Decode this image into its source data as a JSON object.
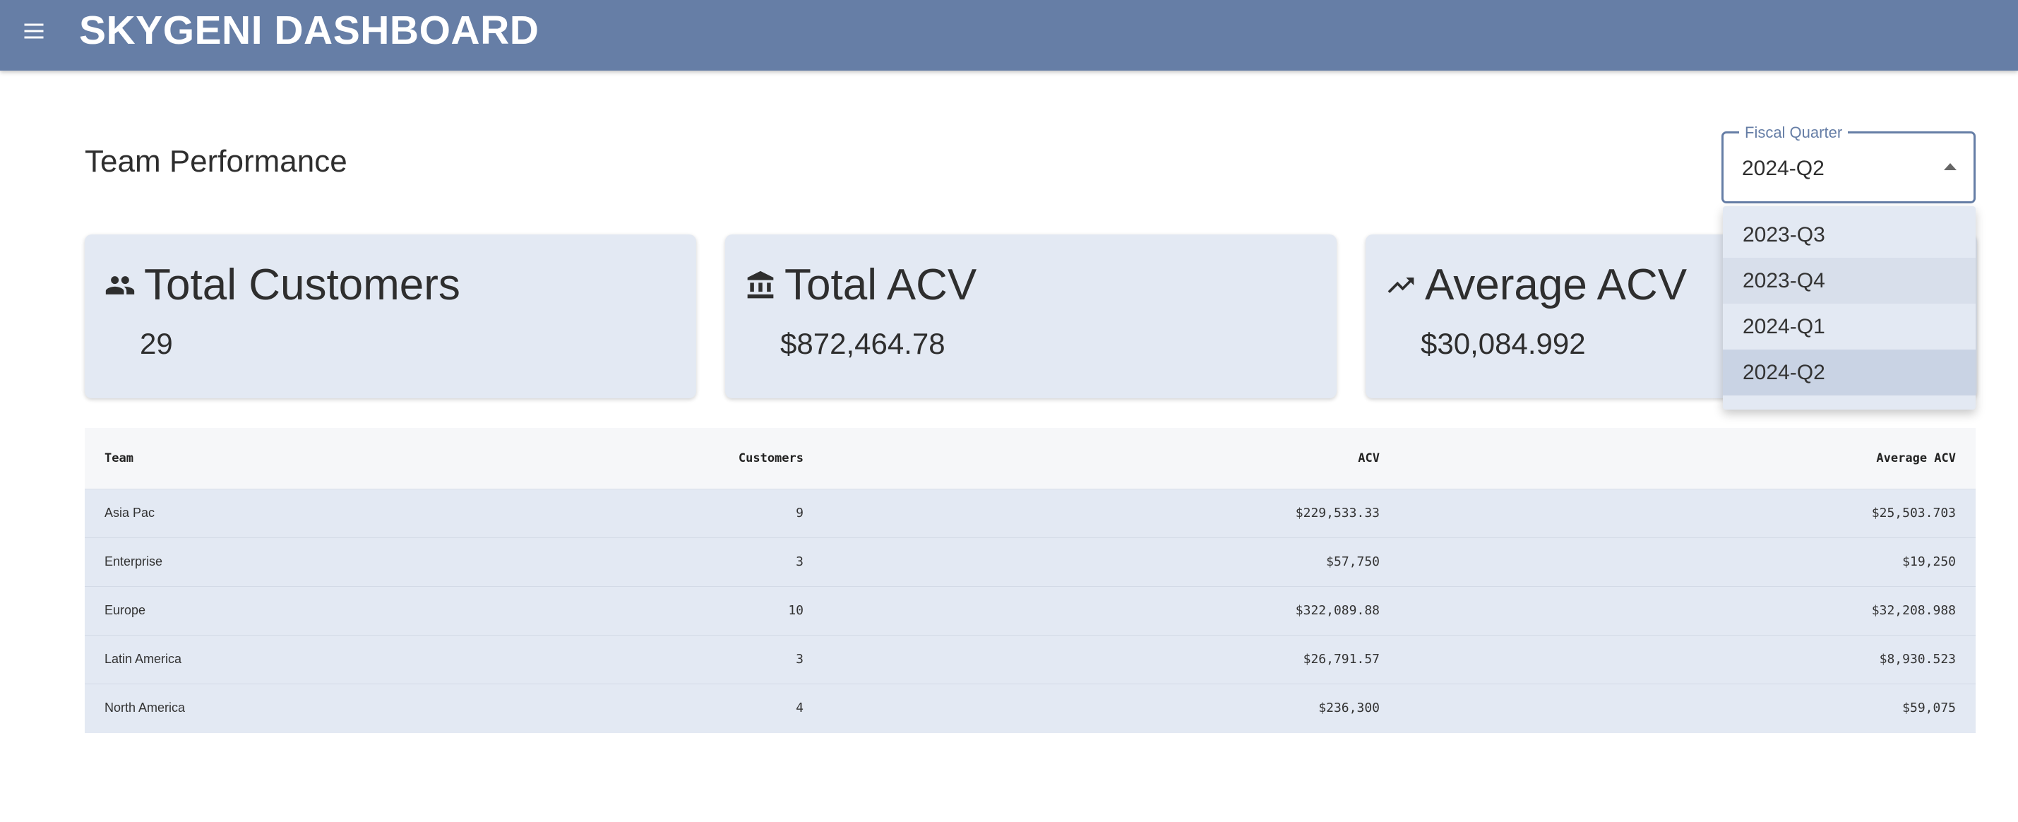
{
  "app": {
    "title": "SKYGENI DASHBOARD",
    "menu_icon": "menu-icon"
  },
  "page": {
    "title": "Team Performance"
  },
  "fiscal_select": {
    "label": "Fiscal Quarter",
    "value": "2024-Q2",
    "options": [
      "2023-Q3",
      "2023-Q4",
      "2024-Q1",
      "2024-Q2"
    ],
    "hovered": "2023-Q4"
  },
  "cards": [
    {
      "icon": "people-icon",
      "title": "Total Customers",
      "value": "29"
    },
    {
      "icon": "bank-icon",
      "title": "Total ACV",
      "value": "$872,464.78"
    },
    {
      "icon": "trending-up-icon",
      "title": "Average ACV",
      "value": "$30,084.992"
    }
  ],
  "table": {
    "headers": {
      "team": "Team",
      "customers": "Customers",
      "acv": "ACV",
      "avg_acv": "Average ACV"
    },
    "rows": [
      {
        "team": "Asia Pac",
        "customers": "9",
        "acv": "$229,533.33",
        "avg_acv": "$25,503.703"
      },
      {
        "team": "Enterprise",
        "customers": "3",
        "acv": "$57,750",
        "avg_acv": "$19,250"
      },
      {
        "team": "Europe",
        "customers": "10",
        "acv": "$322,089.88",
        "avg_acv": "$32,208.988"
      },
      {
        "team": "Latin America",
        "customers": "3",
        "acv": "$26,791.57",
        "avg_acv": "$8,930.523"
      },
      {
        "team": "North America",
        "customers": "4",
        "acv": "$236,300",
        "avg_acv": "$59,075"
      }
    ]
  },
  "colors": {
    "primary": "#667ea6",
    "card_bg": "#e3e9f3",
    "text": "#2e2e2e"
  }
}
